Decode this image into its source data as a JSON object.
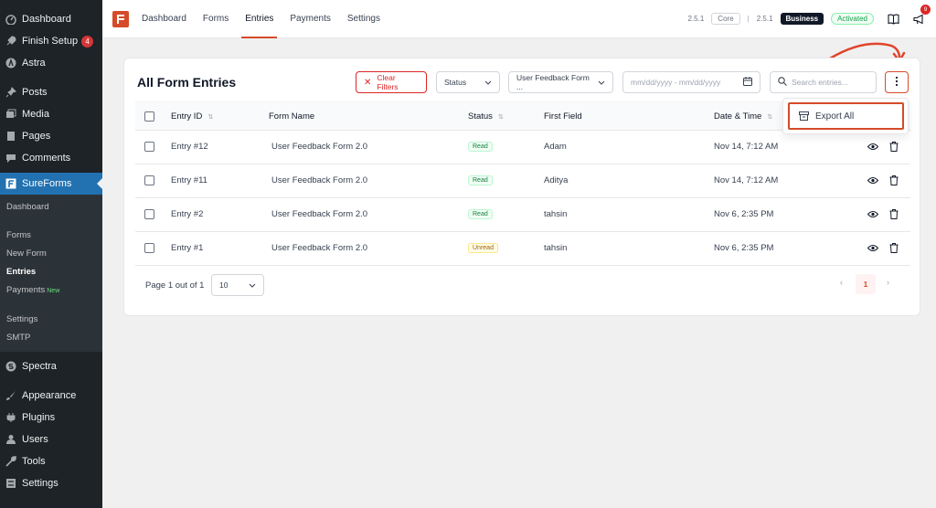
{
  "sidebar": {
    "items_top": [
      {
        "label": "Dashboard",
        "icon": "dashboard-icon"
      },
      {
        "label": "Finish Setup",
        "icon": "rocket-icon",
        "badge": "4"
      },
      {
        "label": "Astra",
        "icon": "astra-icon"
      }
    ],
    "items_mid": [
      {
        "label": "Posts",
        "icon": "pin-icon"
      },
      {
        "label": "Media",
        "icon": "media-icon"
      },
      {
        "label": "Pages",
        "icon": "page-icon"
      },
      {
        "label": "Comments",
        "icon": "comment-icon"
      }
    ],
    "sureforms": "SureForms",
    "submenu": [
      "Dashboard",
      "Forms",
      "New Form",
      "Entries",
      "Payments",
      "Settings",
      "SMTP"
    ],
    "payments_new": "New",
    "items_bottom": [
      {
        "label": "Spectra"
      },
      {
        "label": "Appearance"
      },
      {
        "label": "Plugins"
      },
      {
        "label": "Users"
      },
      {
        "label": "Tools"
      },
      {
        "label": "Settings"
      }
    ]
  },
  "topbar": {
    "tabs": [
      "Dashboard",
      "Forms",
      "Entries",
      "Payments",
      "Settings"
    ],
    "active_tab": "Entries",
    "version_core": "2.5.1",
    "core_label": "Core",
    "separator": "|",
    "version_business": "2.5.1",
    "business_label": "Business",
    "activated_label": "Activated",
    "notification_count": "9"
  },
  "main": {
    "title": "All Form Entries",
    "clear_filters": "Clear Filters",
    "status_filter": "Status",
    "form_filter": "User Feedback Form ...",
    "date_placeholder": "mm/dd/yyyy - mm/dd/yyyy",
    "search_placeholder": "Search entries...",
    "columns": [
      "Entry ID",
      "Form Name",
      "Status",
      "First Field",
      "Date & Time"
    ],
    "rows": [
      {
        "id": "Entry #12",
        "form": "User Feedback Form 2.0",
        "status": "Read",
        "first": "Adam",
        "date": "Nov 14, 7:12 AM"
      },
      {
        "id": "Entry #11",
        "form": "User Feedback Form 2.0",
        "status": "Read",
        "first": "Aditya",
        "date": "Nov 14, 7:12 AM"
      },
      {
        "id": "Entry #2",
        "form": "User Feedback Form 2.0",
        "status": "Read",
        "first": "tahsin",
        "date": "Nov 6, 2:35 PM"
      },
      {
        "id": "Entry #1",
        "form": "User Feedback Form 2.0",
        "status": "Unread",
        "first": "tahsin",
        "date": "Nov 6, 2:35 PM"
      }
    ],
    "page_info": "Page 1 out of 1",
    "per_page": "10",
    "current_page": "1",
    "export_all": "Export All"
  },
  "colors": {
    "accent": "#d54b2a",
    "wp_sidebar": "#1d2327",
    "wp_active": "#2271b1"
  }
}
